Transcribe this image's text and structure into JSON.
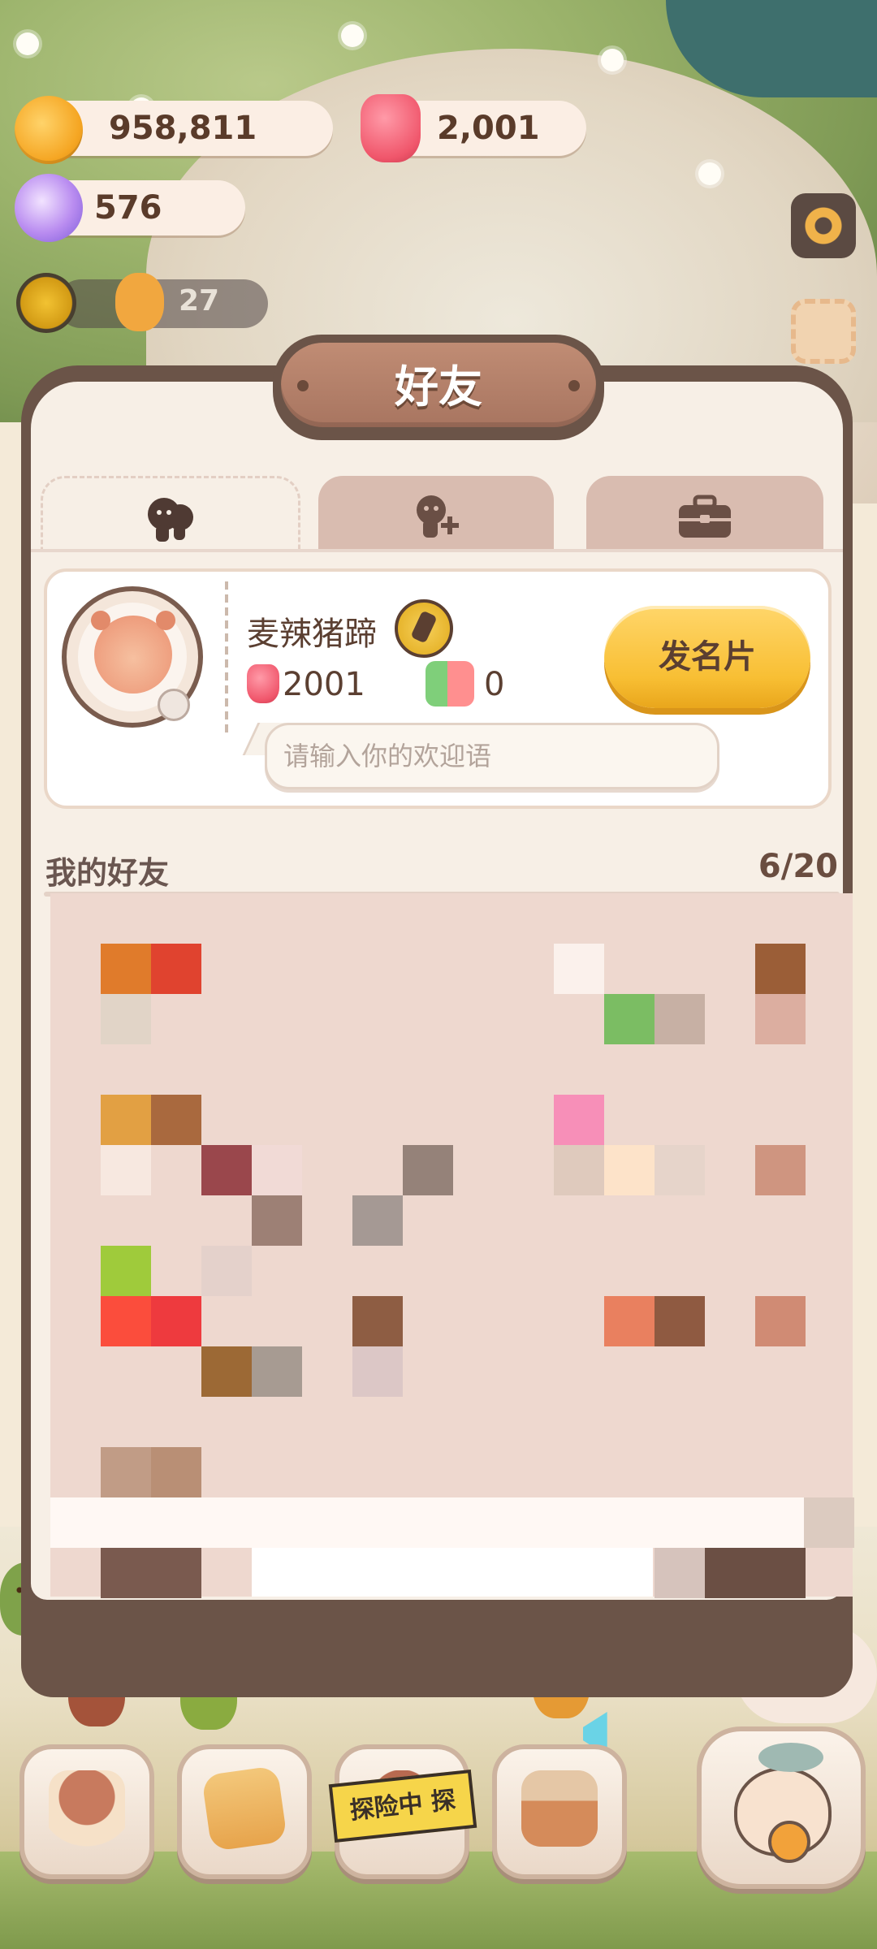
{
  "hud": {
    "cookies": "958,811",
    "jelly": "2,001",
    "crystals": "576",
    "energy": "27"
  },
  "panel": {
    "title": "好友",
    "tabs": [
      {
        "name": "friends-icon"
      },
      {
        "name": "add-friend-icon"
      },
      {
        "name": "briefcase-icon"
      }
    ]
  },
  "profile": {
    "nickname": "麦辣猪蹄",
    "jelly_count": "2001",
    "likes": "0",
    "greeting_placeholder": "请输入你的欢迎语",
    "send_card_label": "发名片"
  },
  "friends": {
    "title": "我的好友",
    "count": "6/20"
  },
  "bottom_nav": {
    "explore_label": "探险中 探"
  },
  "colors": {
    "panel_border": "#6b5448",
    "panel_bg": "#f7efe6",
    "accent_button": "#f8bf34",
    "text_brown": "#5b3f31"
  }
}
